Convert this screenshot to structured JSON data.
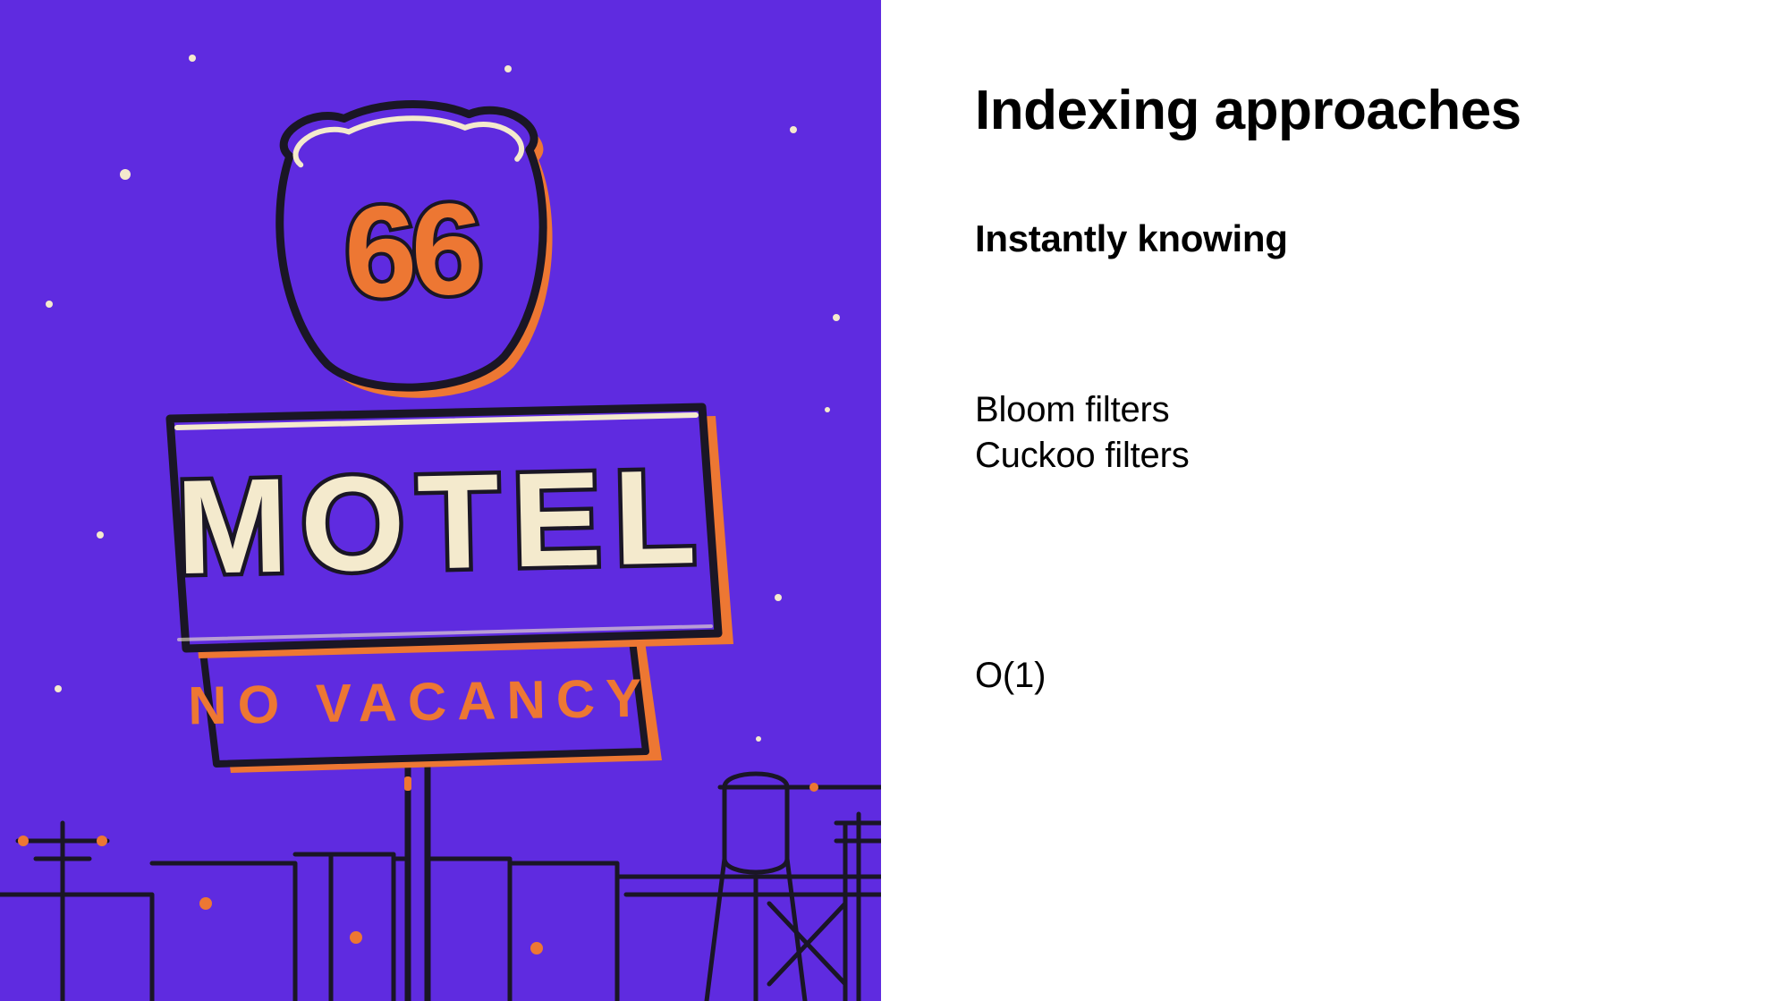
{
  "illustration": {
    "route_number": "66",
    "sign_main": "MOTEL",
    "sign_lower": "NO VACANCY",
    "bg_color": "#5f2be0",
    "accent_color": "#ed7733",
    "cream_color": "#f4eacd",
    "ink_color": "#1a1625"
  },
  "content": {
    "title": "Indexing approaches",
    "subtitle": "Instantly knowing",
    "body1_line1": "Bloom filters",
    "body1_line2": "Cuckoo filters",
    "body2": "O(1)"
  }
}
